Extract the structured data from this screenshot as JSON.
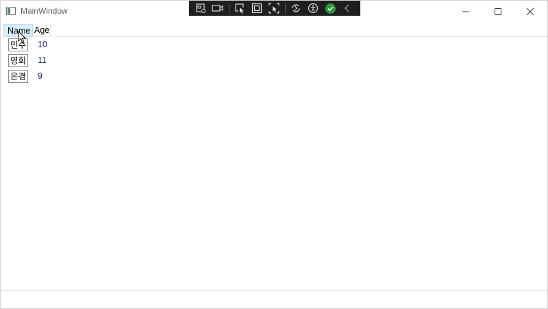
{
  "window": {
    "title": "MainWindow",
    "controls": [
      "minimize-icon",
      "maximize-icon",
      "close-icon"
    ]
  },
  "debug_toolbar": {
    "tools": [
      "live-visual-tree-icon",
      "record-icon",
      "select-element-icon",
      "display-layout-adorners-icon",
      "track-focused-element-icon",
      "hot-reload-icon",
      "accessibility-checker-icon",
      "binding-ok-icon",
      "collapse-chevron-icon"
    ]
  },
  "list": {
    "columns": [
      "Name",
      "Age"
    ],
    "rows": [
      {
        "name": "민수",
        "age": "10"
      },
      {
        "name": "영희",
        "age": "11"
      },
      {
        "name": "은경",
        "age": "9"
      }
    ]
  },
  "colors": {
    "header_selected_bg": "#d9eefa",
    "age_text": "#1a237e",
    "toolbar_bg": "#1f1f1f"
  }
}
